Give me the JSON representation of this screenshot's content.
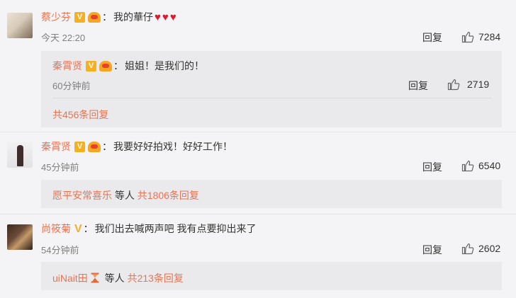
{
  "comments": [
    {
      "user": "蔡少芬",
      "text": "我的華仔",
      "hearts": [
        "♥",
        "♥",
        "♥"
      ],
      "time": "今天 22:20",
      "reply_label": "回复",
      "likes": "7284",
      "sub": {
        "user": "秦霄贤",
        "text": "姐姐！是我们的！",
        "time": "60分钟前",
        "reply_label": "回复",
        "likes": "2719",
        "more": "共456条回复"
      }
    },
    {
      "user": "秦霄贤",
      "text": "我要好好拍戏！好好工作！",
      "time": "45分钟前",
      "reply_label": "回复",
      "likes": "6540",
      "more_user": "愿平安常喜乐",
      "more_mid": " 等人 ",
      "more": "共1806条回复"
    },
    {
      "user": "尚筱菊",
      "text": "我们出去喊两声吧 我有点要抑出来了",
      "time": "54分钟前",
      "reply_label": "回复",
      "likes": "2602",
      "more_user": "uiNait田",
      "more_mid": " 等人 ",
      "more": "共213条回复"
    }
  ],
  "colon": "：",
  "badge_v": "V",
  "colors": {
    "link": "#eb7350",
    "verified": "#f5b022",
    "heart": "#e6162d"
  },
  "icons": {
    "like": "thumb-up-icon",
    "verified": "verified-v-icon",
    "member": "member-crown-icon",
    "hourglass": "hourglass-icon"
  }
}
